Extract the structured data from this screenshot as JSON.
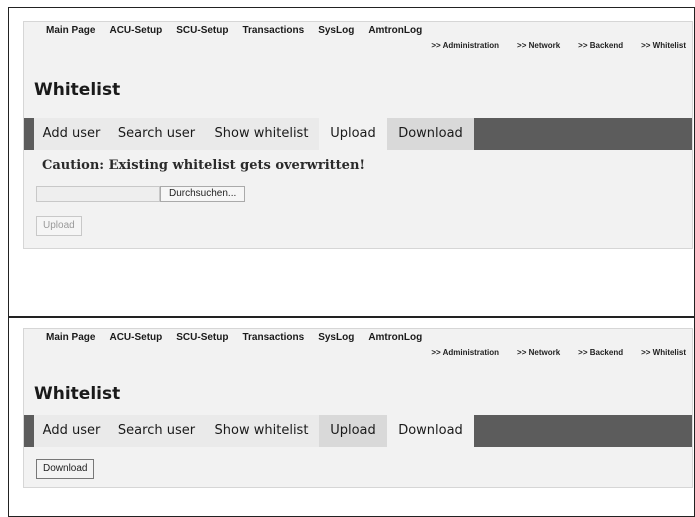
{
  "nav": {
    "items": [
      {
        "label": "Main Page"
      },
      {
        "label": "ACU-Setup"
      },
      {
        "label": "SCU-Setup"
      },
      {
        "label": "Transactions"
      },
      {
        "label": "SysLog"
      },
      {
        "label": "AmtronLog"
      }
    ],
    "breadcrumbs": [
      {
        "label": ">> Administration"
      },
      {
        "label": ">> Network"
      },
      {
        "label": ">> Backend"
      },
      {
        "label": ">> Whitelist"
      }
    ]
  },
  "page_title": "Whitelist",
  "tabs": [
    {
      "label": "Add user"
    },
    {
      "label": "Search user"
    },
    {
      "label": "Show whitelist"
    },
    {
      "label": "Upload"
    },
    {
      "label": "Download"
    }
  ],
  "upload_view": {
    "active_tab": "Upload",
    "caution_text": "Caution: Existing whitelist gets overwritten!",
    "file_path": "",
    "browse_label": "Durchsuchen...",
    "upload_button": "Upload"
  },
  "download_view": {
    "active_tab": "Download",
    "download_button": "Download"
  },
  "colors": {
    "tab_bar": "#5c5c5c",
    "panel_bg": "#f2f2f2"
  }
}
